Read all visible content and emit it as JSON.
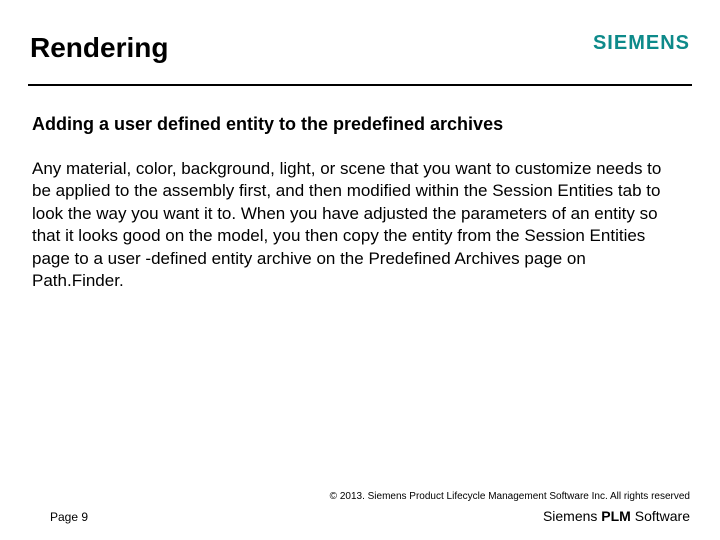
{
  "header": {
    "title": "Rendering",
    "brand": "SIEMENS"
  },
  "content": {
    "subtitle": "Adding a user defined entity to the predefined archives",
    "body": "Any material, color, background, light, or scene that you want to customize needs to be applied to the assembly first, and then modified within the Session Entities tab to look the way you want it to. When you have adjusted the parameters of an entity so that it looks good on the model, you then copy the entity from the Session Entities page to a user -defined entity archive on the Predefined Archives page on Path.Finder."
  },
  "footer": {
    "copyright": "© 2013. Siemens Product Lifecycle Management Software Inc. All rights reserved",
    "page": "Page 9",
    "brand_prefix": "Siemens ",
    "brand_bold": "PLM",
    "brand_suffix": " Software"
  }
}
